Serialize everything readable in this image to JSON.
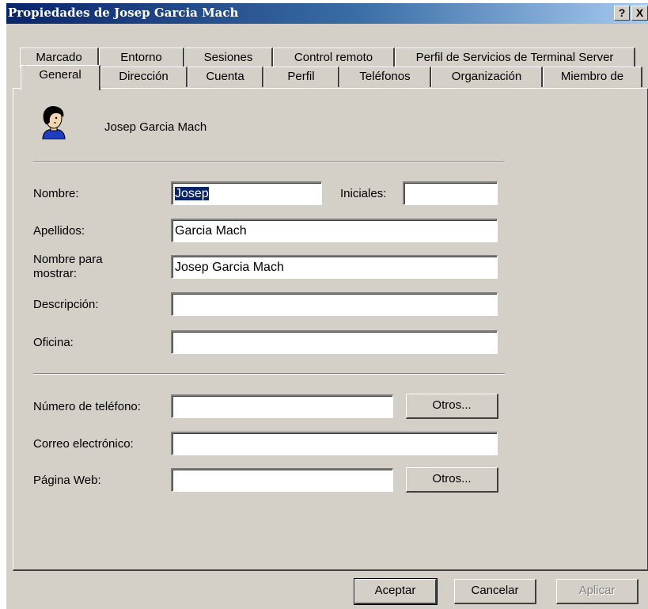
{
  "window": {
    "title": "Propiedades de Josep Garcia Mach",
    "help_button": "?",
    "close_button": "X"
  },
  "tabs": {
    "row1": [
      "Marcado",
      "Entorno",
      "Sesiones",
      "Control remoto",
      "Perfil de Servicios de Terminal Server"
    ],
    "row2": [
      "General",
      "Dirección",
      "Cuenta",
      "Perfil",
      "Teléfonos",
      "Organización",
      "Miembro de"
    ],
    "active": "General"
  },
  "user": {
    "display_name": "Josep Garcia Mach"
  },
  "form": {
    "nombre_label": "Nombre:",
    "nombre_value": "Josep",
    "iniciales_label": "Iniciales:",
    "iniciales_value": "",
    "apellidos_label": "Apellidos:",
    "apellidos_value": "Garcia Mach",
    "mostrar_label_line1": "Nombre para",
    "mostrar_label_line2": "mostrar:",
    "mostrar_value": "Josep Garcia Mach",
    "descripcion_label": "Descripción:",
    "descripcion_value": "",
    "oficina_label": "Oficina:",
    "oficina_value": "",
    "telefono_label": "Número de teléfono:",
    "telefono_value": "",
    "correo_label": "Correo electrónico:",
    "correo_value": "",
    "web_label": "Página Web:",
    "web_value": "",
    "otros_label": "Otros..."
  },
  "buttons": {
    "aceptar": "Aceptar",
    "cancelar": "Cancelar",
    "aplicar": "Aplicar"
  },
  "icons": {
    "user": "user-avatar-icon"
  }
}
